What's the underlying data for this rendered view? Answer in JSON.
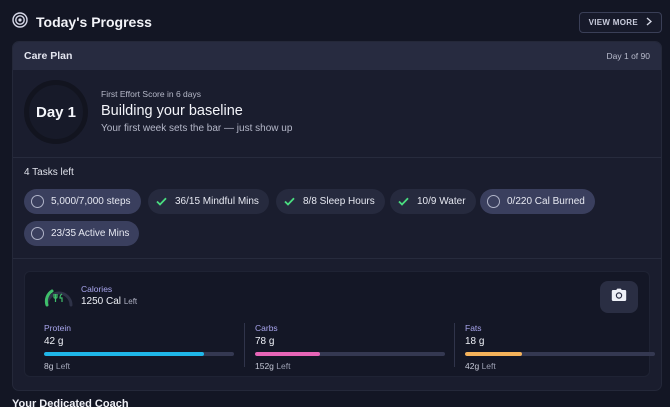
{
  "header": {
    "title": "Today's Progress",
    "view_more_label": "VIEW MORE"
  },
  "care_plan": {
    "title": "Care Plan",
    "day_counter": "Day 1 of 90",
    "day_badge": "Day 1",
    "eyebrow": "First Effort Score in 6 days",
    "headline": "Building your baseline",
    "subtext": "Your first week sets the bar — just show up"
  },
  "tasks": {
    "count_label": "4 Tasks left",
    "items": [
      {
        "label": "5,000/7,000 steps",
        "done": false
      },
      {
        "label": "36/15 Mindful Mins",
        "done": true
      },
      {
        "label": "8/8 Sleep Hours",
        "done": true
      },
      {
        "label": "10/9 Water",
        "done": true
      },
      {
        "label": "0/220 Cal Burned",
        "done": false
      },
      {
        "label": "23/35 Active Mins",
        "done": false
      }
    ]
  },
  "nutrition": {
    "calories": {
      "label": "Calories",
      "value": "1250 Cal",
      "suffix": "Left"
    },
    "macros": [
      {
        "name": "Protein",
        "amount": "42 g",
        "remaining": "8g",
        "remaining_suffix": "Left",
        "progress": 0.84,
        "color": "#1fb6e8"
      },
      {
        "name": "Carbs",
        "amount": "78 g",
        "remaining": "152g",
        "remaining_suffix": "Left",
        "progress": 0.34,
        "color": "#e765b7"
      },
      {
        "name": "Fats",
        "amount": "18 g",
        "remaining": "42g",
        "remaining_suffix": "Left",
        "progress": 0.3,
        "color": "#f5b25a"
      }
    ]
  },
  "coach": {
    "title": "Your Dedicated Coach"
  },
  "colors": {
    "check": "#4ade80",
    "calorie_ring": "#3fbf6b",
    "accent_label": "#a9a6ee"
  },
  "icons": {
    "header": "target-icon",
    "view_more": "chevron-right-icon",
    "camera": "camera-icon",
    "calories": "fork-knife-icon"
  }
}
